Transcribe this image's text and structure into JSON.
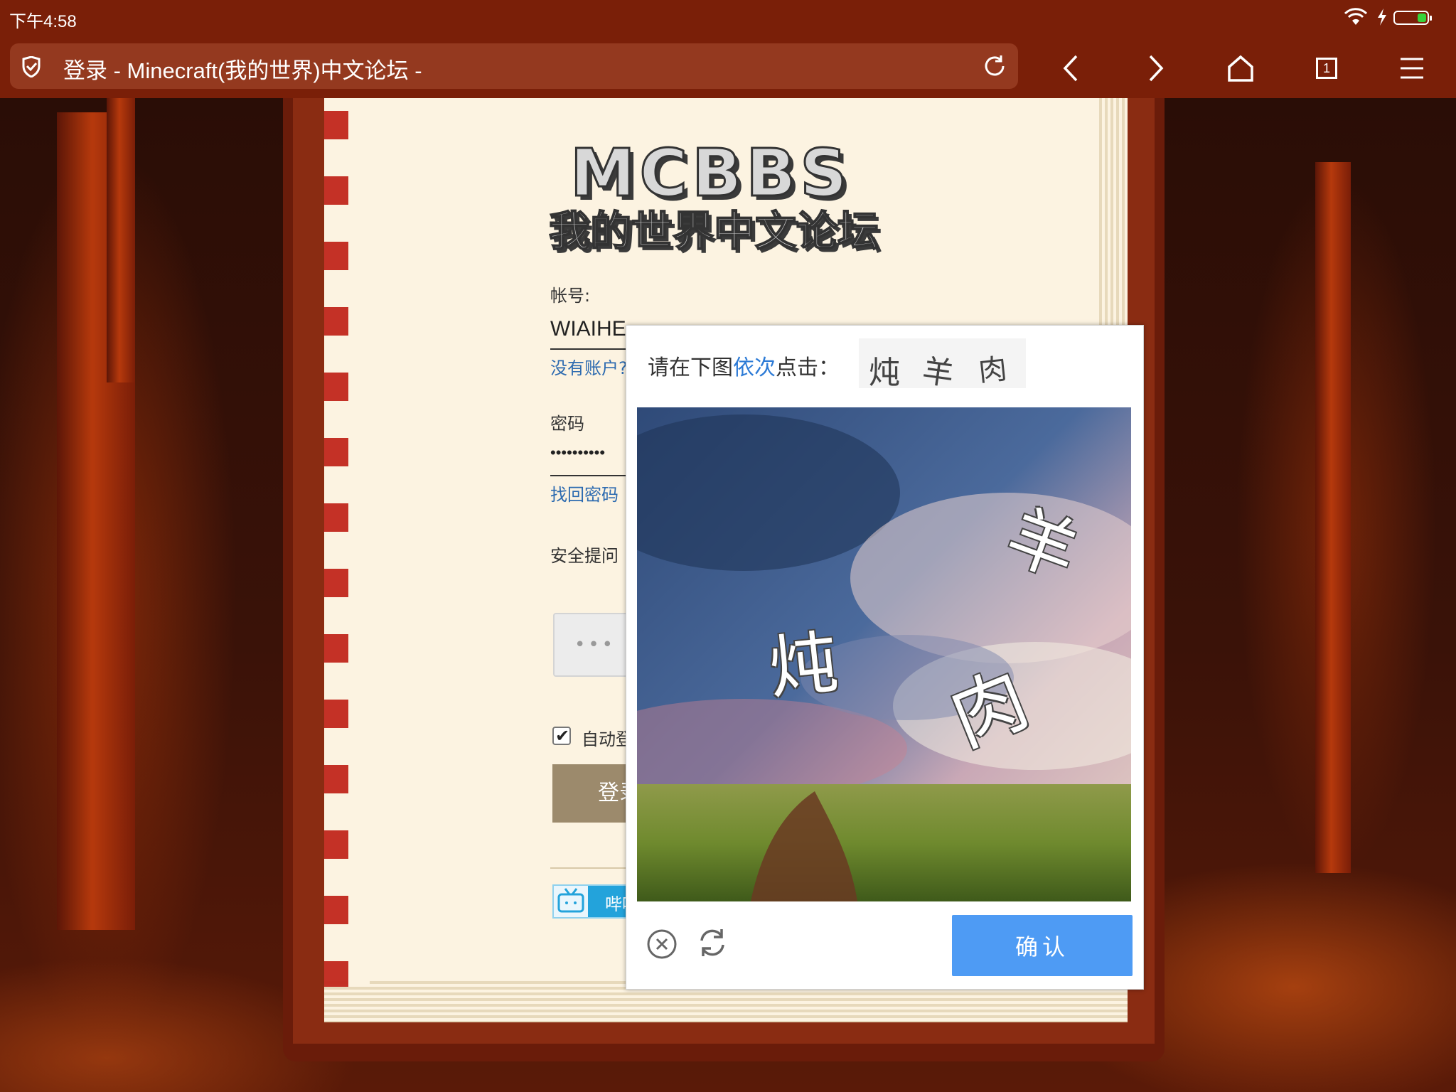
{
  "status_bar": {
    "time": "下午4:58"
  },
  "browser": {
    "page_title": "登录 - Minecraft(我的世界)中文论坛 -",
    "tab_count": "1"
  },
  "logo": {
    "top": "MCBBS",
    "sub": "我的世界中文论坛"
  },
  "form": {
    "account_label": "帐号:",
    "account_value": "WIAIHE",
    "register_link": "没有账户?",
    "password_label": "密码",
    "password_value": "••••••••••",
    "forgot_password_link": "找回密码",
    "security_question_label": "安全提问",
    "captcha_placeholder": "•••",
    "auto_login_label": "自动登录",
    "auto_login_checked": true,
    "login_button": "登录",
    "bilibili_button": "哔哩哔哩"
  },
  "captcha": {
    "prompt_prefix": "请在下图",
    "prompt_highlight": "依次",
    "prompt_suffix": "点击：",
    "targets": [
      "炖",
      "羊",
      "肉"
    ],
    "image_chars": [
      "炖",
      "羊",
      "肉"
    ],
    "confirm_button": "确认",
    "highlight_color": "#2d7bd6",
    "confirm_color": "#4e9bf4"
  },
  "colors": {
    "chrome": "#7a1f08",
    "page": "#fcf3e1",
    "link": "#2d6bb0"
  }
}
